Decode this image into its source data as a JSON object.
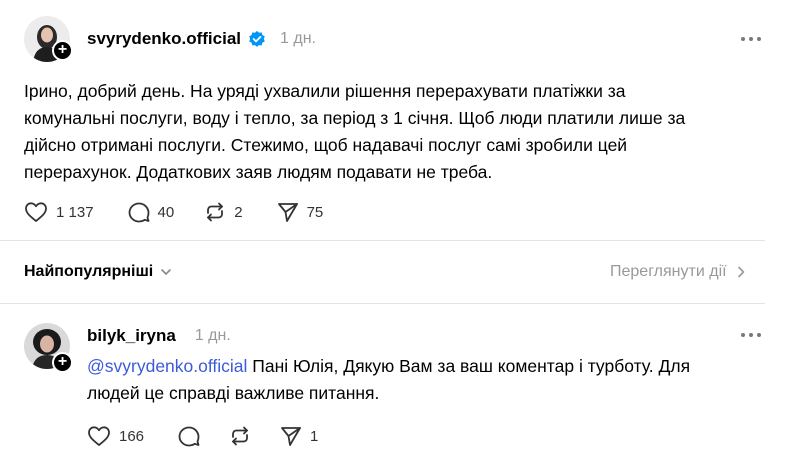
{
  "post": {
    "username": "svyrydenko.official",
    "time": "1 дн.",
    "text": "Ірино, добрий день. На уряді ухвалили рішення перерахувати платіжки за\nкомунальні послуги, воду і тепло, за період з 1 січня. Щоб люди платили лише за\nдійсно отримані послуги. Стежимо, щоб надавачі послуг самі зробили цей\nперерахунок. Додаткових заяв людям подавати не треба.",
    "likes": "1 137",
    "replies": "40",
    "reposts": "2",
    "shares": "75"
  },
  "replies_bar": {
    "sort_label": "Найпопулярніші",
    "activity_link": "Переглянути дії"
  },
  "reply": {
    "username": "bilyk_iryna",
    "time": "1 дн.",
    "mention": "@svyrydenko.official",
    "text_line1_rest": " Пані Юлія, Дякую Вам за ваш коментар і турботу. Для",
    "text_line2": "людей це справді важливе питання.",
    "likes": "166",
    "shares": "1"
  },
  "icons": {
    "verified": "verified-badge-icon",
    "more": "more-options-icon",
    "like": "heart-icon",
    "reply": "comment-icon",
    "repost": "repost-icon",
    "share": "send-icon",
    "sort": "chevron-down-icon",
    "activity": "chevron-right-icon",
    "follow": "plus-icon"
  },
  "colors": {
    "verified": "#0095f6",
    "muted": "#999999",
    "mention": "#3b5bdb"
  }
}
